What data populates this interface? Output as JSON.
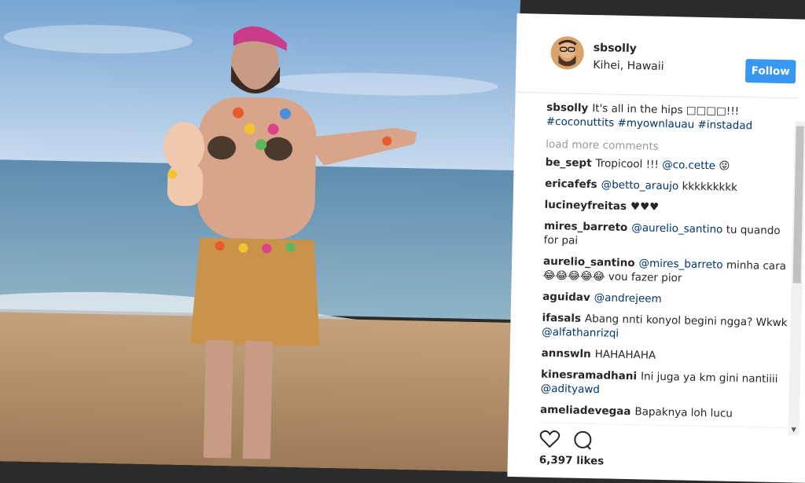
{
  "post": {
    "username": "sbsolly",
    "location": "Kihei, Hawaii",
    "follow_label": "Follow",
    "caption": {
      "user": "sbsolly",
      "text": "It's all in the hips □□□□!!!",
      "hashtags": "#coconuttits #myownlauau #instadad"
    },
    "load_more": "load more comments",
    "comments": [
      {
        "user": "be_sept",
        "text": "Tropicool !!! ",
        "mention": "@co.cette",
        "suffix": " 😜"
      },
      {
        "user": "ericafefs",
        "text": "",
        "mention": "@betto_araujo",
        "suffix": " kkkkkkkkk"
      },
      {
        "user": "lucineyfreitas",
        "text": "♥♥♥",
        "mention": "",
        "suffix": ""
      },
      {
        "user": "mires_barreto",
        "text": "",
        "mention": "@aurelio_santino",
        "suffix": " tu quando for pai"
      },
      {
        "user": "aurelio_santino",
        "text": "",
        "mention": "@mires_barreto",
        "suffix": " minha cara 😂😂😂😂😂 vou fazer pior"
      },
      {
        "user": "aguidav",
        "text": "",
        "mention": "@andrejeem",
        "suffix": ""
      },
      {
        "user": "ifasals",
        "text": "Abang nnti konyol begini ngga? Wkwk ",
        "mention": "@alfathanrizqi",
        "suffix": ""
      },
      {
        "user": "annswln",
        "text": "HAHAHAHA",
        "mention": "",
        "suffix": ""
      },
      {
        "user": "kinesramadhani",
        "text": "Ini juga ya km gini nantiiii ",
        "mention": "@adityawd",
        "suffix": ""
      },
      {
        "user": "ameliadevegaa",
        "text": "Bapaknya loh lucu",
        "mention": "",
        "suffix": ""
      }
    ],
    "likes": "6,397 likes"
  },
  "icons": {
    "heart": "heart-icon",
    "comment": "comment-icon"
  },
  "colors": {
    "follow_button": "#3897f0",
    "link": "#003569",
    "muted": "#999999"
  }
}
